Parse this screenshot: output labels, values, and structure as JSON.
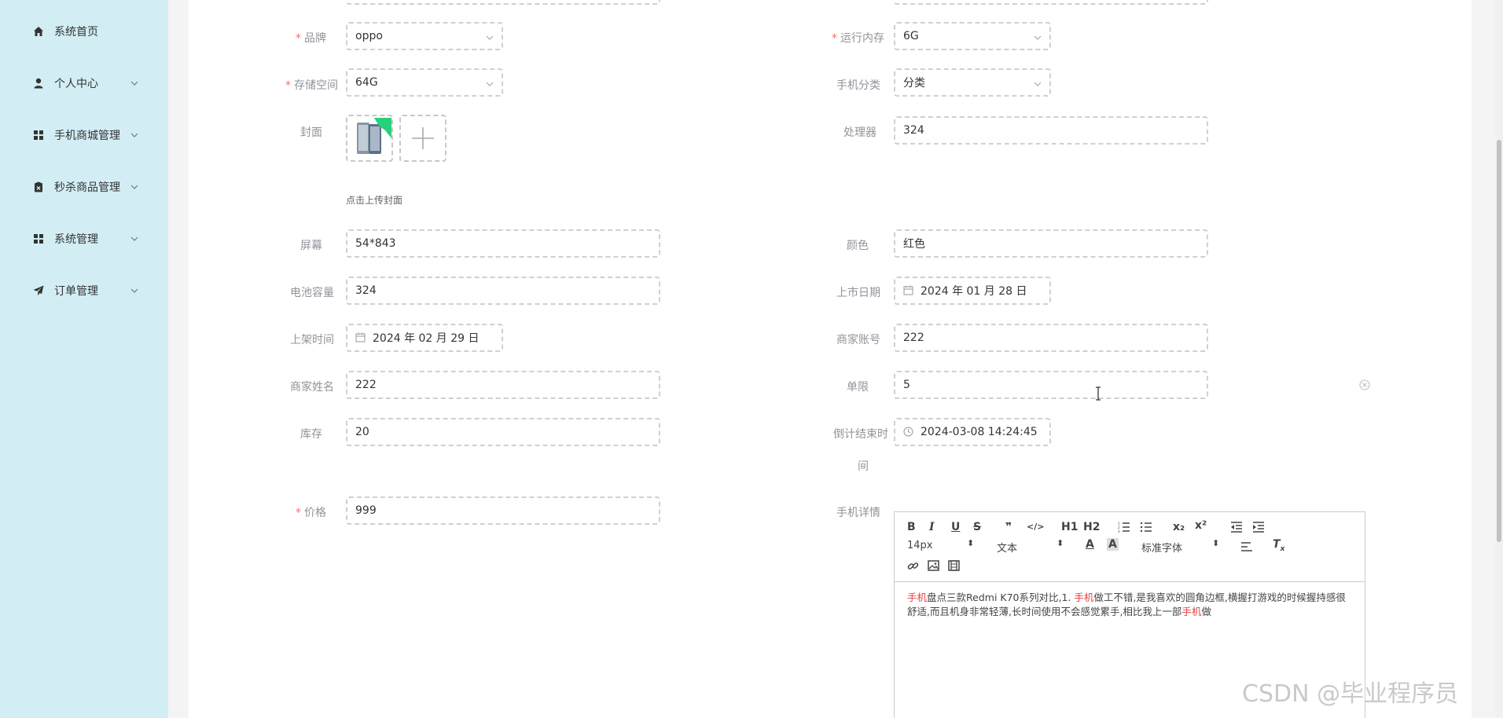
{
  "sidebar": {
    "items": [
      {
        "label": "系统首页",
        "icon": "home-icon"
      },
      {
        "label": "个人中心",
        "icon": "user-icon"
      },
      {
        "label": "手机商城管理",
        "icon": "grid-icon"
      },
      {
        "label": "秒杀商品管理",
        "icon": "clipboard-x-icon"
      },
      {
        "label": "系统管理",
        "icon": "grid-icon"
      },
      {
        "label": "订单管理",
        "icon": "send-icon"
      }
    ]
  },
  "form": {
    "brand": {
      "label": "品牌",
      "value": "oppo"
    },
    "ram": {
      "label": "运行内存",
      "value": "6G"
    },
    "storage": {
      "label": "存储空间",
      "value": "64G"
    },
    "category": {
      "label": "手机分类",
      "value": "分类"
    },
    "cover": {
      "label": "封面",
      "hint": "点击上传封面"
    },
    "processor": {
      "label": "处理器",
      "value": "324"
    },
    "screen": {
      "label": "屏幕",
      "value": "54*843"
    },
    "color": {
      "label": "颜色",
      "value": "红色"
    },
    "battery": {
      "label": "电池容量",
      "value": "324"
    },
    "release_date": {
      "label": "上市日期",
      "value": "2024 年 01 月 28 日"
    },
    "shelf_time": {
      "label": "上架时间",
      "value": "2024 年 02 月 29 日"
    },
    "merchant_account": {
      "label": "商家账号",
      "value": "222"
    },
    "merchant_name": {
      "label": "商家姓名",
      "value": "222"
    },
    "limit": {
      "label": "单限",
      "value": "5"
    },
    "stock": {
      "label": "库存",
      "value": "20"
    },
    "countdown_end": {
      "label_line1": "倒计结束时",
      "label_line2": "间",
      "value": "2024-03-08 14:24:45"
    },
    "price": {
      "label": "价格",
      "value": "999"
    },
    "details": {
      "label": "手机详情"
    }
  },
  "editor": {
    "toolbar": {
      "bold": "B",
      "italic": "I",
      "underline": "U",
      "strike": "S",
      "quote": "❞",
      "code": "</>",
      "h1": "H1",
      "h2": "H2",
      "sub": "x₂",
      "sup": "x²",
      "size": "14px",
      "header": "文本",
      "font": "标准字体"
    },
    "content_parts": [
      {
        "text": "手机",
        "hl": true
      },
      {
        "text": "盘点三款Redmi K70系列对比,1. ",
        "hl": false
      },
      {
        "text": "手机",
        "hl": true
      },
      {
        "text": "做工不错,是我喜欢的圆角边框,横握打游戏的时候握持感很舒适,而且机身非常轻薄,长时间使用不会感觉累手,相比我上一部",
        "hl": false
      },
      {
        "text": "手机",
        "hl": true
      },
      {
        "text": "做",
        "hl": false
      }
    ]
  },
  "watermark": "CSDN @毕业程序员"
}
